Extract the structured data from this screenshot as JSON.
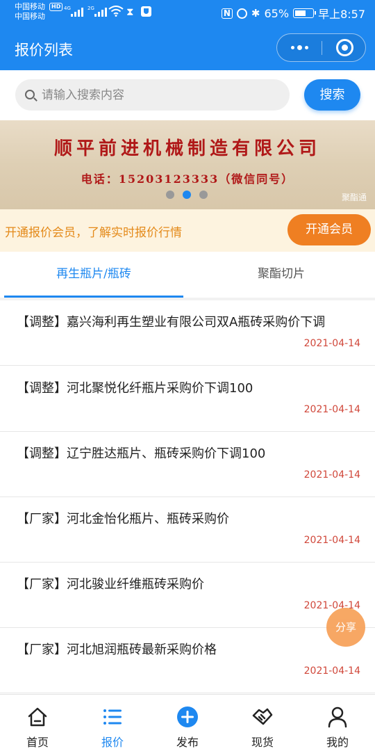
{
  "status_bar": {
    "carrier1": "中国移动",
    "carrier2": "中国移动",
    "hd": "HD",
    "sig1": "4G",
    "sig2": "2G",
    "nfc": "N",
    "battery": "65%",
    "time": "早上8:57"
  },
  "header": {
    "title": "报价列表"
  },
  "search": {
    "placeholder": "请输入搜索内容",
    "button": "搜索"
  },
  "banner": {
    "company": "顺平前进机械制造有限公司",
    "phone": "电话：15203123333（微信同号）",
    "watermark": "聚酯通",
    "active_slide": 2,
    "slide_count": 3
  },
  "member": {
    "text": "开通报价会员，了解实时报价行情",
    "button": "开通会员"
  },
  "tabs": [
    {
      "label": "再生瓶片/瓶砖",
      "active": true
    },
    {
      "label": "聚酯切片",
      "active": false
    }
  ],
  "items": [
    {
      "title": "【调整】嘉兴海利再生塑业有限公司双A瓶砖采购价下调",
      "date": "2021-04-14"
    },
    {
      "title": "【调整】河北聚悦化纤瓶片采购价下调100",
      "date": "2021-04-14"
    },
    {
      "title": "【调整】辽宁胜达瓶片、瓶砖采购价下调100",
      "date": "2021-04-14"
    },
    {
      "title": "【厂家】河北金怡化瓶片、瓶砖采购价",
      "date": "2021-04-14"
    },
    {
      "title": "【厂家】河北骏业纤维瓶砖采购价",
      "date": "2021-04-14"
    },
    {
      "title": "【厂家】河北旭润瓶砖最新采购价格",
      "date": "2021-04-14"
    }
  ],
  "share": "分享",
  "tabbar": [
    {
      "label": "首页",
      "icon": "home-icon"
    },
    {
      "label": "报价",
      "icon": "list-icon",
      "active": true
    },
    {
      "label": "发布",
      "icon": "plus-circle-icon"
    },
    {
      "label": "现货",
      "icon": "handshake-icon"
    },
    {
      "label": "我的",
      "icon": "user-icon"
    }
  ],
  "colors": {
    "primary": "#1e88f0",
    "accent": "#ef7f22",
    "date": "#d0473a",
    "banner_text": "#b01818"
  }
}
